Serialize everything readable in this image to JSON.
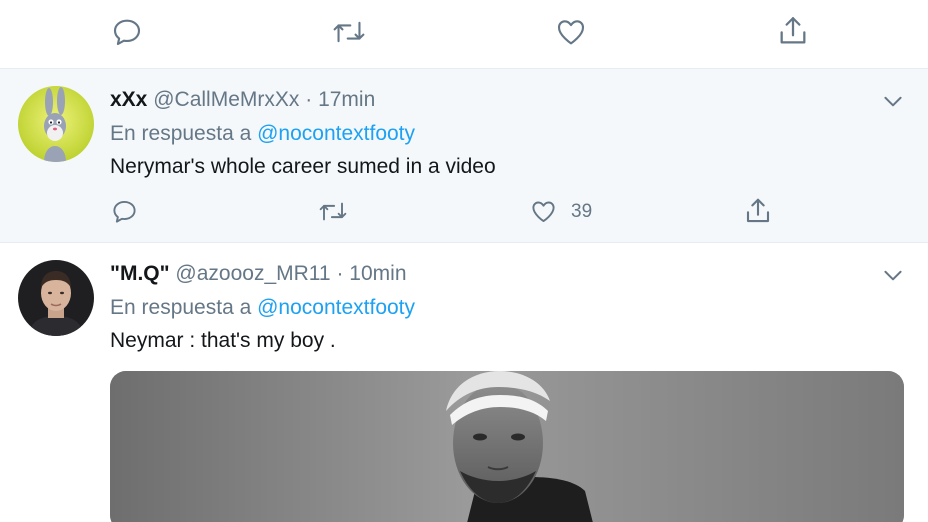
{
  "top_actions": {
    "reply_icon": "reply-icon",
    "retweet_icon": "retweet-icon",
    "like_icon": "heart-icon",
    "share_icon": "share-icon"
  },
  "tweets": [
    {
      "display_name": "xXx",
      "handle": "@CallMeMrxXx",
      "separator": "·",
      "time": "17min",
      "reply_prefix": "En respuesta a",
      "reply_to": "@nocontextfooty",
      "text": "Nerymar's whole career sumed in a video",
      "like_count": "39",
      "avatar": "cartoon-rabbit-avatar",
      "background": "#f5f8fa"
    },
    {
      "display_name": "\"M.Q\"",
      "handle": "@azoooz_MR11",
      "separator": "·",
      "time": "10min",
      "reply_prefix": "En respuesta a",
      "reply_to": "@nocontextfooty",
      "text": "Neymar : that's my boy .",
      "avatar": "man-portrait-avatar",
      "media": "black-and-white-photo-of-man-in-headband"
    }
  ],
  "colors": {
    "link": "#1da1f2",
    "secondary_text": "#657786",
    "primary_text": "#14171a",
    "divider": "#e6ecf0"
  }
}
